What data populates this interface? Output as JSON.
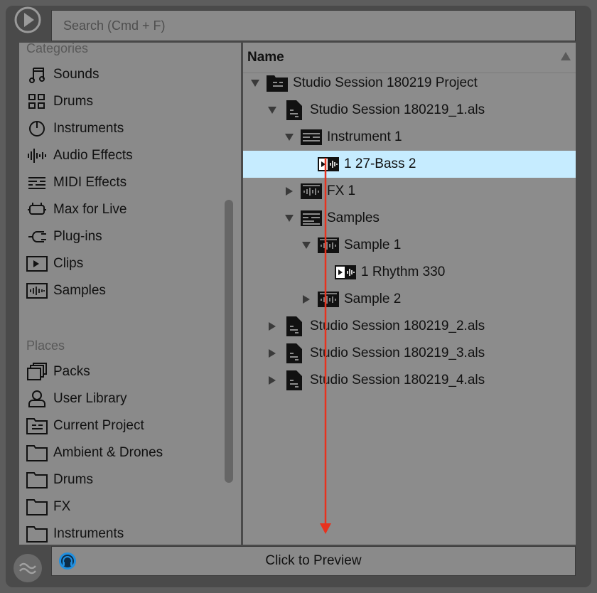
{
  "search": {
    "placeholder": "Search (Cmd + F)"
  },
  "categories": {
    "title": "Categories",
    "items": [
      {
        "label": "Sounds",
        "icon": "music-note-icon"
      },
      {
        "label": "Drums",
        "icon": "drum-grid-icon"
      },
      {
        "label": "Instruments",
        "icon": "knob-icon"
      },
      {
        "label": "Audio Effects",
        "icon": "audio-wave-icon"
      },
      {
        "label": "MIDI Effects",
        "icon": "midi-lines-icon"
      },
      {
        "label": "Max for Live",
        "icon": "max-icon"
      },
      {
        "label": "Plug-ins",
        "icon": "plug-icon"
      },
      {
        "label": "Clips",
        "icon": "clip-play-icon"
      },
      {
        "label": "Samples",
        "icon": "sample-wave-icon"
      }
    ]
  },
  "places": {
    "title": "Places",
    "items": [
      {
        "label": "Packs",
        "icon": "packs-icon"
      },
      {
        "label": "User Library",
        "icon": "user-icon"
      },
      {
        "label": "Current Project",
        "icon": "project-folder-icon"
      },
      {
        "label": "Ambient & Drones",
        "icon": "folder-icon"
      },
      {
        "label": "Drums",
        "icon": "folder-icon"
      },
      {
        "label": "FX",
        "icon": "folder-icon"
      },
      {
        "label": "Instruments",
        "icon": "folder-icon"
      }
    ]
  },
  "browser": {
    "column_header": "Name",
    "rows": [
      {
        "label": "Studio Session 180219 Project",
        "type": "project",
        "expanded": true
      },
      {
        "label": "Studio Session 180219_1.als",
        "type": "set",
        "expanded": true
      },
      {
        "label": "Instrument 1",
        "type": "track",
        "expanded": true
      },
      {
        "label": "1 27-Bass 2",
        "type": "clip",
        "selected": true
      },
      {
        "label": "FX 1",
        "type": "fx-track",
        "expanded": false
      },
      {
        "label": "Samples",
        "type": "track",
        "expanded": true
      },
      {
        "label": "Sample 1",
        "type": "sample",
        "expanded": true
      },
      {
        "label": "1 Rhythm 330",
        "type": "clip"
      },
      {
        "label": "Sample 2",
        "type": "sample",
        "expanded": false
      },
      {
        "label": "Studio Session 180219_2.als",
        "type": "set",
        "expanded": false
      },
      {
        "label": "Studio Session 180219_3.als",
        "type": "set",
        "expanded": false
      },
      {
        "label": "Studio Session 180219_4.als",
        "type": "set",
        "expanded": false
      }
    ]
  },
  "footer": {
    "preview_label": "Click to Preview"
  },
  "colors": {
    "selection": "#c6ecff",
    "drag_arrow": "#e8321e",
    "headphone_accent": "#1f8fe0"
  }
}
